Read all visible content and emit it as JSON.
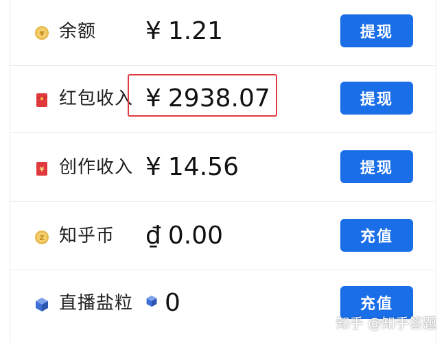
{
  "rows": [
    {
      "label": "余额",
      "currency": "¥",
      "amount": "1.21",
      "button": "提现",
      "icon": "yuan-coin-icon"
    },
    {
      "label": "红包收入",
      "currency": "¥",
      "amount": "2938.07",
      "button": "提现",
      "icon": "red-envelope-icon",
      "highlighted": true
    },
    {
      "label": "创作收入",
      "currency": "¥",
      "amount": "14.56",
      "button": "提现",
      "icon": "red-envelope-yuan-icon"
    },
    {
      "label": "知乎币",
      "currency": "₫",
      "amount": "0.00",
      "button": "充值",
      "icon": "zhihu-coin-icon"
    },
    {
      "label": "直播盐粒",
      "amount": "0",
      "button": "充值",
      "icon": "salt-gem-icon"
    }
  ],
  "watermark": "知乎 @知乎答题",
  "colors": {
    "button_blue": "#1a6fe8",
    "highlight_red": "#e0393d",
    "coin_gold": "#e8b84a",
    "envelope_red": "#e0393d",
    "gem_blue": "#3d6fd6"
  }
}
